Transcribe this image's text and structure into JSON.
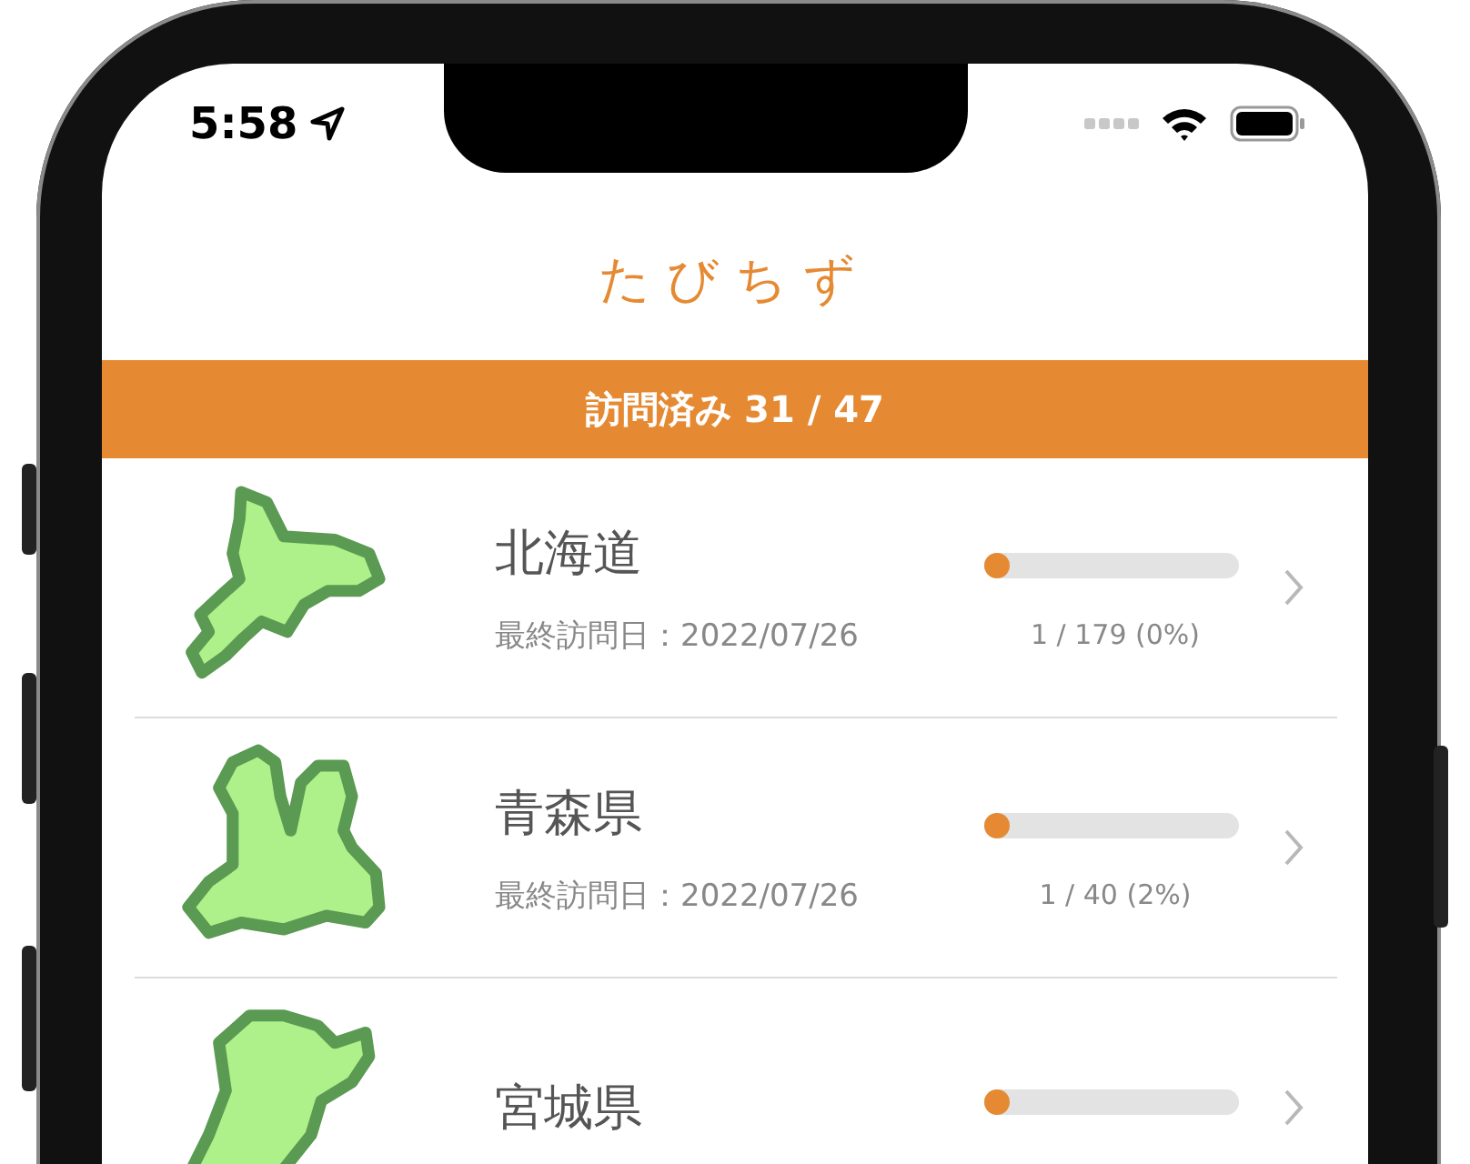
{
  "status_bar": {
    "time": "5:58"
  },
  "title": "たびちず",
  "summary": "訪問済み 31 / 47",
  "prefectures": [
    {
      "name": "北海道",
      "last_visit": "最終訪問日：2022/07/26",
      "level": 0.1,
      "count": "1 / 179 (0%)"
    },
    {
      "name": "青森県",
      "last_visit": "最終訪問日：2022/07/26",
      "level": 0.1,
      "count": "1 / 40 (2%)"
    },
    {
      "name": "宮城県",
      "level": 0.1
    }
  ]
}
